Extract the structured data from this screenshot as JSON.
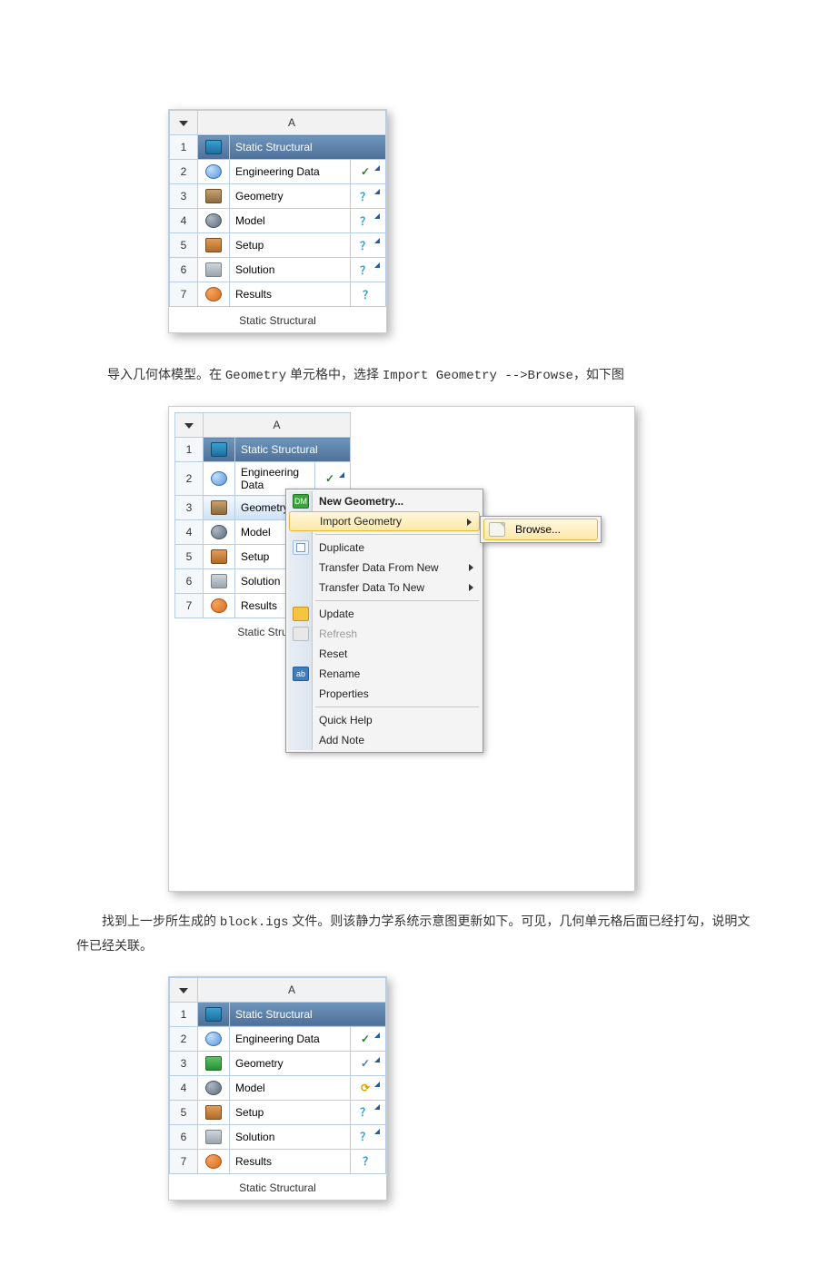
{
  "columnHeader": "A",
  "systemTitle": "Static Structural",
  "caption": "Static Structural",
  "rows": {
    "r1": "Static Structural",
    "r2": "Engineering Data",
    "r3": "Geometry",
    "r4": "Model",
    "r5": "Setup",
    "r6": "Solution",
    "r7": "Results"
  },
  "status": {
    "check": "✓",
    "question": "？",
    "refresh": "⟳"
  },
  "para1_pre": "导入几何体模型。在 ",
  "para1_geo": "Geometry",
  "para1_mid": " 单元格中，选择 ",
  "para1_imp": "Import Geometry -->Browse",
  "para1_suf": "，如下图",
  "para2_a": "找到上一步所生成的 ",
  "para2_file": "block.igs",
  "para2_b": " 文件。则该静力学系统示意图更新如下。可见，几何单元格后面已经打勾，说明文件已经关联。",
  "fig2_caption": "Static Stru",
  "menu": {
    "newGeom": "New Geometry...",
    "importGeom": "Import Geometry",
    "duplicate": "Duplicate",
    "transferFrom": "Transfer Data From New",
    "transferTo": "Transfer Data To New",
    "update": "Update",
    "refresh": "Refresh",
    "reset": "Reset",
    "rename": "Rename",
    "properties": "Properties",
    "quickHelp": "Quick Help",
    "addNote": "Add Note"
  },
  "submenu": {
    "browse": "Browse..."
  },
  "dm_icon_text": "DM",
  "rename_icon_text": "ab"
}
